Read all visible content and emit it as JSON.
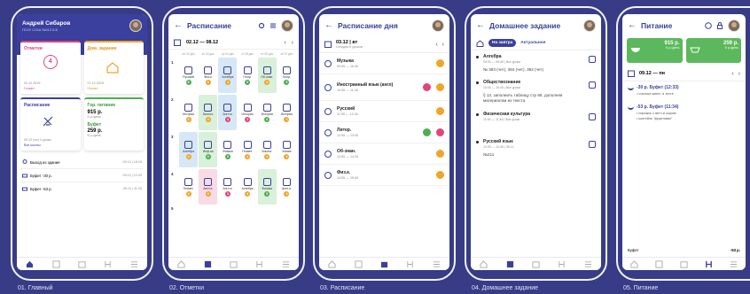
{
  "captions": [
    "01. Главный",
    "02. Отметки",
    "03. Расписание",
    "04. Домашнее задание",
    "05. Питание"
  ],
  "s1": {
    "name": "Андрей Сибаров",
    "school": "ГБОУ СОШ №313 8 Б",
    "marks": {
      "title": "Отметки",
      "value": "4",
      "date": "02.12.2019",
      "subject": "Геомет."
    },
    "hw": {
      "title": "Дом. задание",
      "date": "07.12.2019",
      "subject": "Геомет."
    },
    "schedule": {
      "title": "Расписание",
      "time": "09:12 (пн) 4 урока",
      "link": "Все школы"
    },
    "food": {
      "title": "Гор. питание",
      "price": "915 р.",
      "per": "6 р./день"
    },
    "buffet": {
      "title": "Буфет",
      "price": "259 р.",
      "per": "6 р./день"
    },
    "events": [
      {
        "text": "Выход из здания",
        "time": "09.12 | 15:19"
      },
      {
        "text": "Буфет -30 р.",
        "time": "09.12 | 12:33"
      },
      {
        "text": "Буфет -53 р.",
        "time": "09.12 | 11:34"
      }
    ]
  },
  "s2": {
    "title": "Расписание",
    "range": "02.12 — 08.12",
    "days": [
      "пн 02 дек",
      "вт 03 дек",
      "ср 04 дек",
      "чт 05 дек",
      "пт 06 дек",
      "сб 07 дек"
    ],
    "rows": [
      [
        {
          "s": "Русский",
          "m": "5"
        },
        {
          "s": "Физ-к.",
          "m": "4"
        },
        {
          "s": "Алгебра",
          "m": "4"
        },
        {
          "s": "Геогр.",
          "m": "5"
        },
        {
          "s": "Об-знан.",
          "m": "4"
        },
        {
          "s": "Геогр.",
          "m": "5"
        }
      ],
      [
        {
          "s": "История",
          "m": "4"
        },
        {
          "s": "Биолог.",
          "m": "4"
        },
        {
          "s": "Англ.я.",
          "m": "3"
        },
        {
          "s": "История",
          "m": "3"
        },
        {
          "s": "История",
          "m": "5"
        },
        {
          "s": "История",
          "m": "4"
        }
      ],
      [
        {
          "s": "Алгебра",
          "m": "4"
        },
        {
          "s": "Инф-ка",
          "m": "5"
        },
        {
          "s": "Физика",
          "m": "5"
        },
        {
          "s": "Геомет.",
          "m": "4"
        },
        {
          "s": "Биолог.",
          "m": "4"
        },
        {
          "s": "Химия",
          "m": "4"
        }
      ],
      [
        {
          "s": "Геомет.",
          "m": "4"
        },
        {
          "s": "Англ.я.",
          "m": "4"
        },
        {
          "s": "Англ.я.",
          "m": "3"
        },
        {
          "s": "Алгебра",
          "m": "4"
        },
        {
          "s": "Физика",
          "m": "5"
        },
        {
          "s": "Англ.я.",
          "m": "4"
        }
      ]
    ]
  },
  "s3": {
    "title": "Расписание дня",
    "date": "03.12",
    "weekday": "вт",
    "sub": "Сегодня 6 уроков",
    "lessons": [
      {
        "n": "Музыка",
        "t": "09:55 — 10:40"
      },
      {
        "n": "Иностранный язык (англ)",
        "t": "10:55 — 11:40"
      },
      {
        "n": "Русский",
        "t": "11:55 — 12:40"
      },
      {
        "n": "Литер.",
        "t": "12:55 — 13:40"
      },
      {
        "n": "Об-знан.",
        "t": "13:55 — 14:40"
      },
      {
        "n": "Физ.к.",
        "t": "14:55 — 15:40"
      }
    ]
  },
  "s4": {
    "title": "Домашнее задание",
    "tab1": "На завтра",
    "tab2": "Актуальное",
    "items": [
      {
        "n": "Алгебра",
        "t": "09:00 — 09:45 | Все уроки",
        "d": "№ 383 (чет), 384 (чет), 392 (чет)"
      },
      {
        "n": "Обществознание",
        "t": "10:00 — 10:45 | Все уроки",
        "d": "§ 13, заполнить таблицу стр 86, дополняя материалом из текста"
      },
      {
        "n": "Физическая культура",
        "t": "11:00 — 11:45 | Все уроки",
        "d": ""
      },
      {
        "n": "Русский язык",
        "t": "12:00 — 12:45 | 06.12",
        "d": "№211"
      }
    ]
  },
  "s5": {
    "title": "Питание",
    "food": {
      "price": "915 р.",
      "per": "6 р./день"
    },
    "buffet": {
      "price": "259 р.",
      "per": "6 р./день"
    },
    "date": "09.12 — пн",
    "ops": [
      {
        "a": "-30 р.",
        "p": "Буфет (12:33)",
        "items": [
          "• сосиска запеч. в тесте"
        ]
      },
      {
        "a": "-53 р.",
        "p": "Буфет (11:34)",
        "items": [
          "• пирожок с ветч.и сыром",
          "• коктейль \"фруктовик\""
        ]
      }
    ],
    "footer": {
      "l": "Буфет",
      "r": "-53 р."
    }
  }
}
